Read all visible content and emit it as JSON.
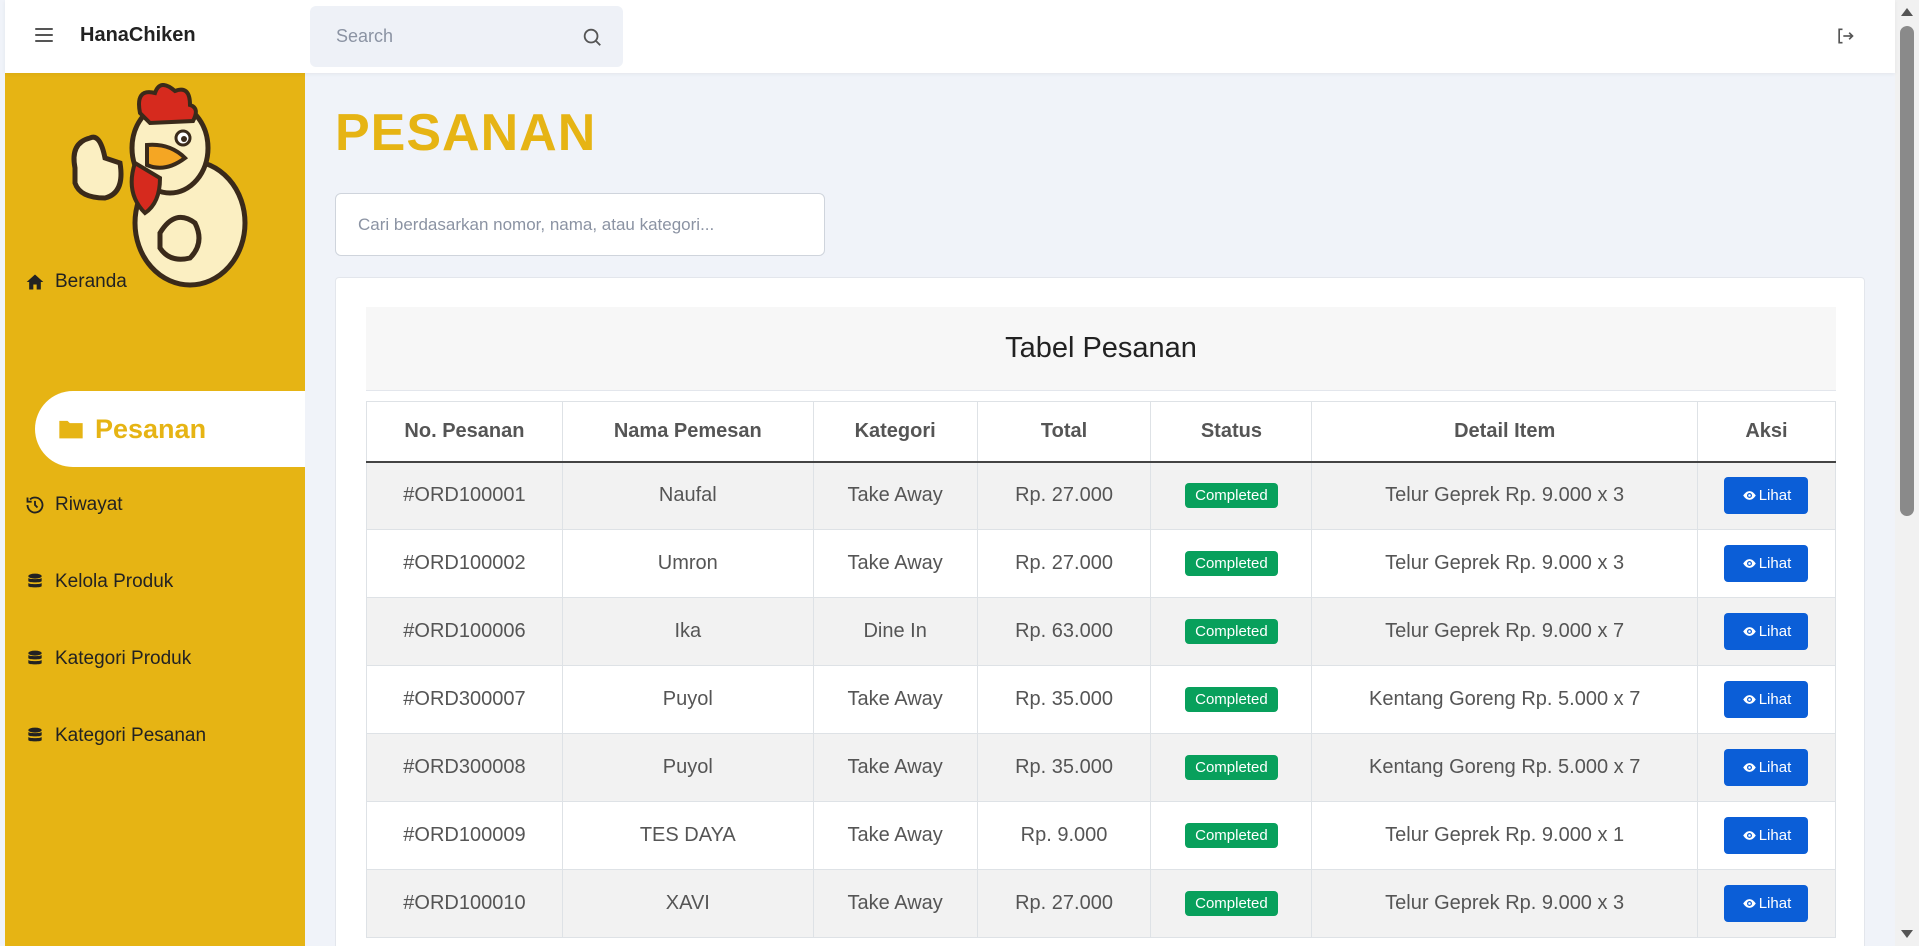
{
  "header": {
    "brand": "HanaChiken",
    "search_placeholder": "Search"
  },
  "sidebar": {
    "items": [
      {
        "label": "Beranda",
        "icon": "home-icon"
      },
      {
        "label": "Pesanan",
        "icon": "folder-icon",
        "active": true
      },
      {
        "label": "Riwayat",
        "icon": "history-icon"
      },
      {
        "label": "Kelola Produk",
        "icon": "database-icon"
      },
      {
        "label": "Kategori Produk",
        "icon": "database-icon"
      },
      {
        "label": "Kategori Pesanan",
        "icon": "database-icon"
      }
    ]
  },
  "main": {
    "title": "PESANAN",
    "filter_placeholder": "Cari berdasarkan nomor, nama, atau kategori...",
    "table_title": "Tabel Pesanan",
    "columns": [
      "No. Pesanan",
      "Nama Pemesan",
      "Kategori",
      "Total",
      "Status",
      "Detail Item",
      "Aksi"
    ],
    "rows": [
      {
        "no": "#ORD100001",
        "nama": "Naufal",
        "kategori": "Take Away",
        "total": "Rp. 27.000",
        "status": "Completed",
        "detail": "Telur Geprek Rp. 9.000 x 3",
        "aksi": "Lihat"
      },
      {
        "no": "#ORD100002",
        "nama": "Umron",
        "kategori": "Take Away",
        "total": "Rp. 27.000",
        "status": "Completed",
        "detail": "Telur Geprek Rp. 9.000 x 3",
        "aksi": "Lihat"
      },
      {
        "no": "#ORD100006",
        "nama": "Ika",
        "kategori": "Dine In",
        "total": "Rp. 63.000",
        "status": "Completed",
        "detail": "Telur Geprek Rp. 9.000 x 7",
        "aksi": "Lihat"
      },
      {
        "no": "#ORD300007",
        "nama": "Puyol",
        "kategori": "Take Away",
        "total": "Rp. 35.000",
        "status": "Completed",
        "detail": "Kentang Goreng Rp. 5.000 x 7",
        "aksi": "Lihat"
      },
      {
        "no": "#ORD300008",
        "nama": "Puyol",
        "kategori": "Take Away",
        "total": "Rp. 35.000",
        "status": "Completed",
        "detail": "Kentang Goreng Rp. 5.000 x 7",
        "aksi": "Lihat"
      },
      {
        "no": "#ORD100009",
        "nama": "TES DAYA",
        "kategori": "Take Away",
        "total": "Rp. 9.000",
        "status": "Completed",
        "detail": "Telur Geprek Rp. 9.000 x 1",
        "aksi": "Lihat"
      },
      {
        "no": "#ORD100010",
        "nama": "XAVI",
        "kategori": "Take Away",
        "total": "Rp. 27.000",
        "status": "Completed",
        "detail": "Telur Geprek Rp. 9.000 x 3",
        "aksi": "Lihat"
      }
    ]
  },
  "colors": {
    "accent": "#e6b414",
    "status_completed": "#08a05c",
    "button_primary": "#0b5ed7"
  }
}
